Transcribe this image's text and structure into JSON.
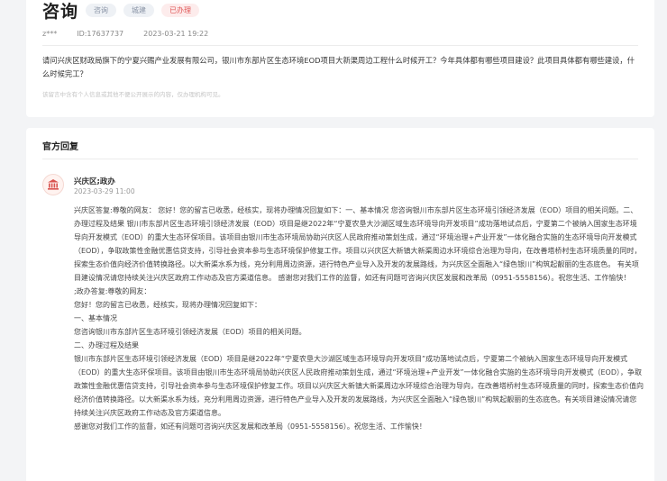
{
  "header": {
    "title": "咨询",
    "tags": [
      "咨询",
      "城建",
      "已办理"
    ],
    "author": "z***",
    "id_text": "ID:17637737",
    "datetime": "2023-03-21 19:22"
  },
  "question": {
    "text": "请问兴庆区财政局旗下的宁夏兴赐产业发展有限公司，银川市东部片区生态环境EOD项目大新渠周边工程什么时候开工？今年具体都有哪些项目建设？此项目具体都有哪些建设，什么时候完工？",
    "note": "该留言中含有个人信息或其他不便公开展示的内容，仅办理机构可见。"
  },
  "reply": {
    "section_title": "官方回复",
    "department": "兴庆区;政办",
    "date": "2023-03-29 11:00",
    "paragraphs": [
      "兴庆区答复:尊敬的网友：  您好！您的留言已收悉，经核实，现将办理情况回复如下：一、基本情况 您咨询银川市东部片区生态环境引领经济发展（EOD）项目的相关问题。二、办理过程及结果 银川市东部片区生态环境引领经济发展（EOD）项目是继2022年“宁夏农垦大沙湖区域生态环境导向开发项目”成功落地试点后，宁夏第二个被纳入国家生态环境导向开发模式（EOD）的重大生态环保项目。该项目由银川市生态环境局协助兴庆区人民政府推动策划生成，通过“环境治理+产业开发”一体化融合实施的生态环境导向开发模式（EOD），争取政策性金融优惠信贷支持，引导社会资本参与生态环境保护修复工作。项目以兴庆区大新镇大新渠周边水环境综合治理为导向，在改善塔桥村生态环境质量的同时，探索生态价值向经济价值转换路径。以大新渠水系为线，充分利用周边资源，进行特色产业导入及开发的发展路线，为兴庆区全面融入“绿色银川”构筑起靓丽的生态底色。 有关项目建设情况请您持续关注兴庆区政府工作动态及官方渠道信息。 感谢您对我们工作的监督，如还有问题可咨询兴庆区发展和改革局（0951-5558156）。祝您生活、工作愉快！",
      ";政办答复:尊敬的网友：",
      "您好！您的留言已收悉，经核实，现将办理情况回复如下：",
      "一、基本情况",
      "您咨询银川市东部片区生态环境引领经济发展（EOD）项目的相关问题。",
      "二、办理过程及结果",
      "银川市东部片区生态环境引领经济发展（EOD）项目是继2022年“宁夏农垦大沙湖区域生态环境导向开发项目”成功落地试点后，宁夏第二个被纳入国家生态环境导向开发模式（EOD）的重大生态环保项目。该项目由银川市生态环境局协助兴庆区人民政府推动策划生成，通过“环境治理+产业开发”一体化融合实施的生态环境导向开发模式（EOD），争取政策性金融优惠信贷支持，引导社会资本参与生态环境保护修复工作。项目以兴庆区大新镇大新渠周边水环境综合治理为导向，在改善塔桥村生态环境质量的同时，探索生态价值向经济价值转换路径。以大新渠水系为线，充分利用周边资源，进行特色产业导入及开发的发展路线，为兴庆区全面融入“绿色银川”构筑起靓丽的生态底色。有关项目建设情况请您持续关注兴庆区政府工作动态及官方渠道信息。",
      "感谢您对我们工作的监督，如还有问题可咨询兴庆区发展和改革局（0951-5558156）。祝您生活、工作愉快！"
    ]
  },
  "colors": {
    "page_bg": "#f3f4f6",
    "tag_grey_text": "#8a94a6",
    "tag_red_text": "#e05656",
    "avatar_icon": "#d9534f"
  },
  "icons": {
    "avatar": "government-building-icon"
  }
}
